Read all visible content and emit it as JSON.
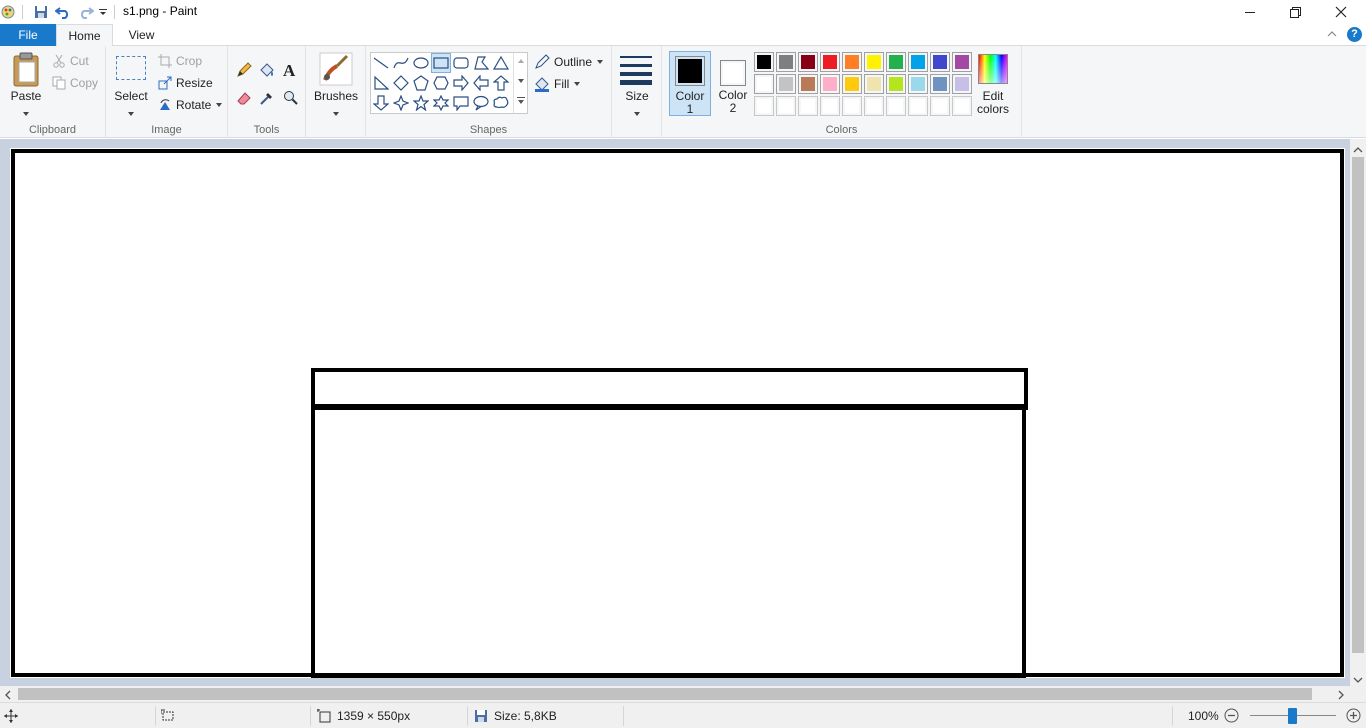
{
  "window": {
    "title": "s1.png - Paint"
  },
  "tabs": {
    "file": "File",
    "home": "Home",
    "view": "View"
  },
  "clipboard": {
    "paste": "Paste",
    "cut": "Cut",
    "copy": "Copy",
    "group": "Clipboard"
  },
  "image": {
    "select": "Select",
    "crop": "Crop",
    "resize": "Resize",
    "rotate": "Rotate",
    "group": "Image"
  },
  "tools": {
    "group": "Tools"
  },
  "brushes": {
    "label": "Brushes"
  },
  "shapes": {
    "outline": "Outline",
    "fill": "Fill",
    "group": "Shapes"
  },
  "size": {
    "label": "Size"
  },
  "colors": {
    "color1": "Color",
    "color1_num": "1",
    "color2": "Color",
    "color2_num": "2",
    "edit_line1": "Edit",
    "edit_line2": "colors",
    "group": "Colors",
    "color1_value": "#000000",
    "color2_value": "#ffffff",
    "palette_row1": [
      "#000000",
      "#7f7f7f",
      "#880015",
      "#ed1c24",
      "#ff7f27",
      "#fff200",
      "#22b14c",
      "#00a2e8",
      "#3f48cc",
      "#a349a4"
    ],
    "palette_row2": [
      "#ffffff",
      "#c3c3c3",
      "#b97a57",
      "#ffaec9",
      "#ffc90e",
      "#efe4b0",
      "#b5e61d",
      "#99d9ea",
      "#7092be",
      "#c8bfe7"
    ],
    "palette_row3": [
      "#ffffff",
      "#ffffff",
      "#ffffff",
      "#ffffff",
      "#ffffff",
      "#ffffff",
      "#ffffff",
      "#ffffff",
      "#ffffff",
      "#ffffff"
    ]
  },
  "status": {
    "dimensions": "1359 × 550px",
    "size": "Size: 5,8KB",
    "zoom": "100%"
  }
}
